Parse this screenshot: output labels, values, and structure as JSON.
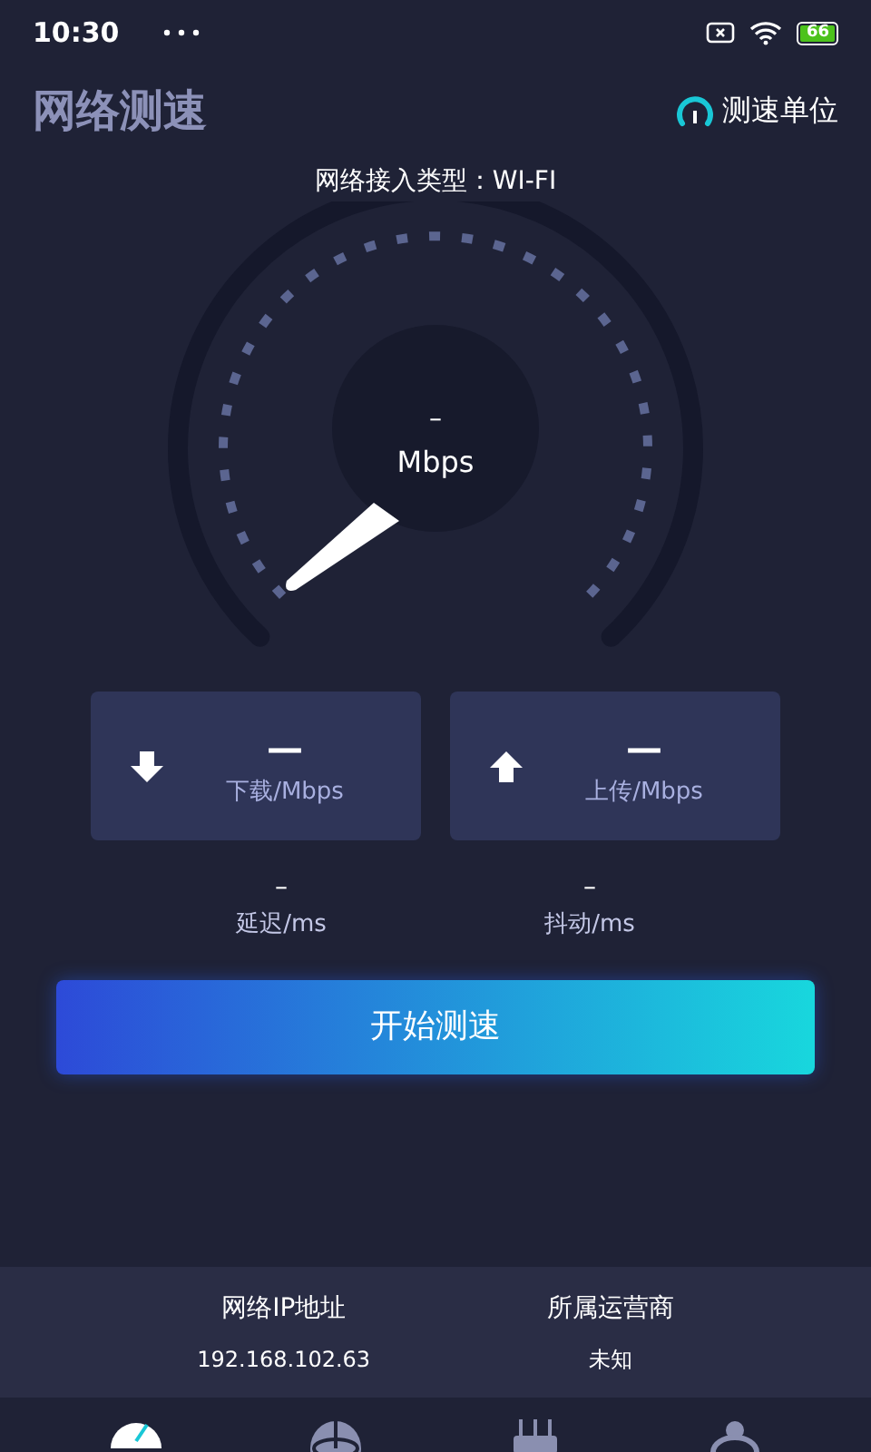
{
  "status_bar": {
    "time": "10:30",
    "battery": "66"
  },
  "header": {
    "title": "网络测速",
    "unit_button": "测速单位"
  },
  "network_type": "网络接入类型：WI-FI",
  "gauge": {
    "value": "–",
    "unit": "Mbps"
  },
  "speed_cards": [
    {
      "kind": "download",
      "value": "—",
      "label": "下载/Mbps"
    },
    {
      "kind": "upload",
      "value": "—",
      "label": "上传/Mbps"
    }
  ],
  "metrics": [
    {
      "value": "–",
      "label": "延迟/ms"
    },
    {
      "value": "–",
      "label": "抖动/ms"
    }
  ],
  "start_button": "开始测速",
  "info": [
    {
      "label": "网络IP地址",
      "value": "192.168.102.63"
    },
    {
      "label": "所属运营商",
      "value": "未知"
    }
  ],
  "nav": [
    {
      "kind": "speed",
      "selected": true
    },
    {
      "kind": "globe",
      "selected": false
    },
    {
      "kind": "router",
      "selected": false
    },
    {
      "kind": "user",
      "selected": false
    }
  ]
}
